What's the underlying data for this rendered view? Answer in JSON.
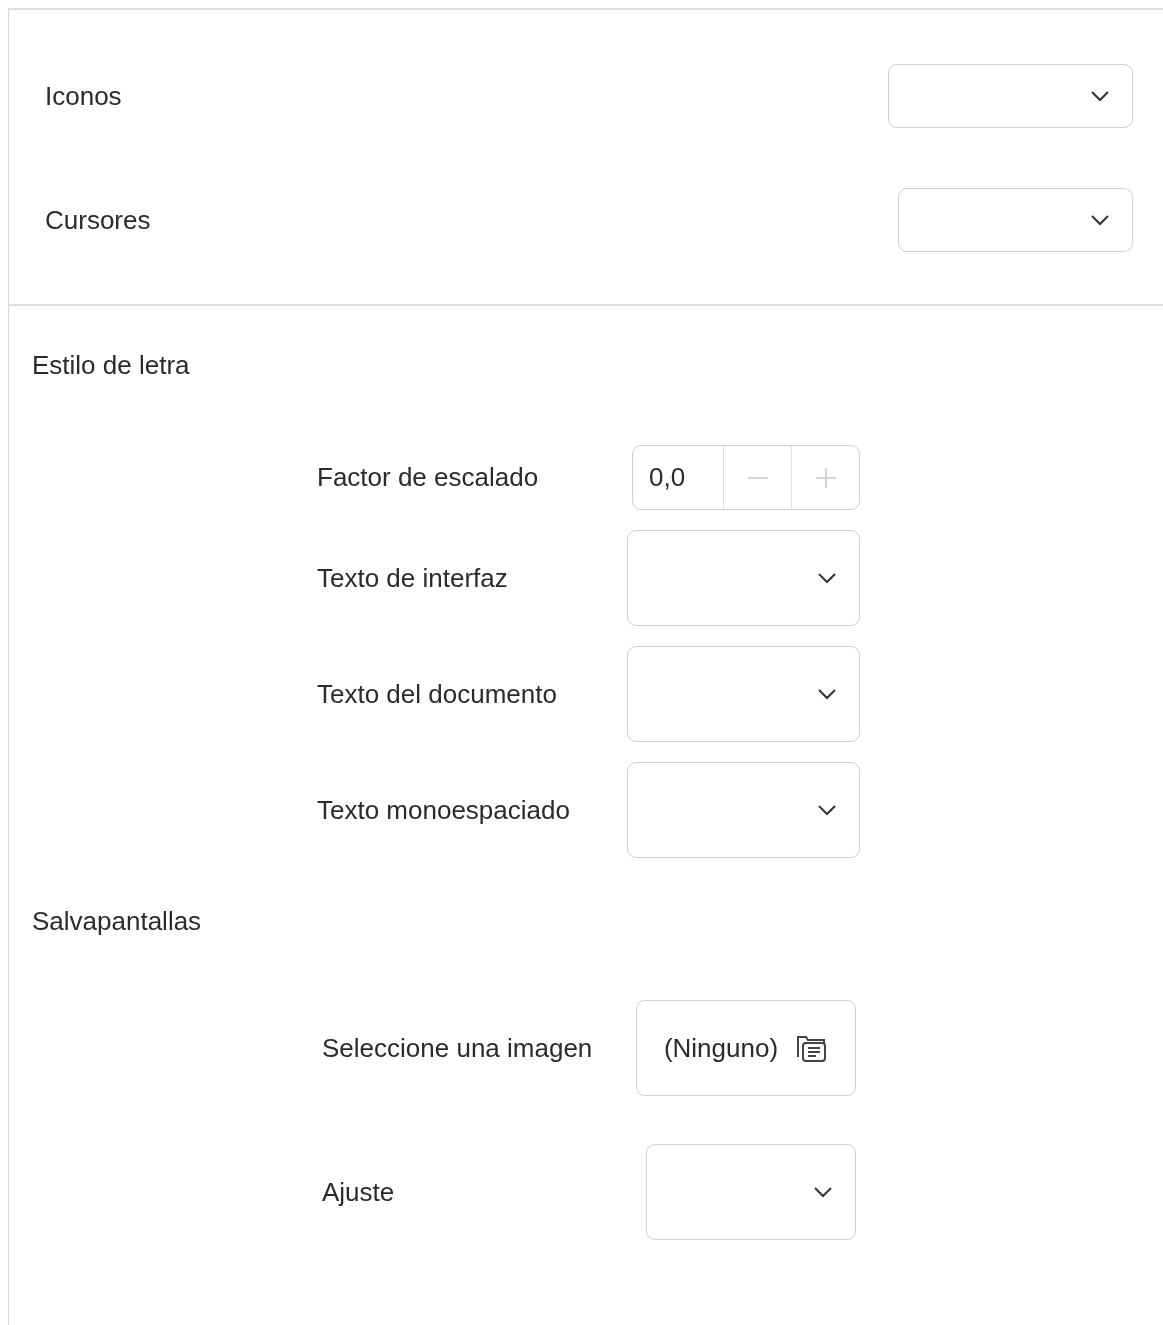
{
  "theme_panel": {
    "rows": [
      {
        "label": "Iconos",
        "kind": "dropdown"
      },
      {
        "label": "Cursores",
        "kind": "dropdown"
      }
    ]
  },
  "sections": [
    {
      "title": "Estilo de letra",
      "rows": [
        {
          "label": "Factor de escalado",
          "kind": "spin",
          "value": "0,0",
          "decrement_disabled": true,
          "increment_disabled": true
        },
        {
          "label": "Texto de interfaz",
          "kind": "dropdown"
        },
        {
          "label": "Texto del documento",
          "kind": "dropdown"
        },
        {
          "label": "Texto monoespaciado",
          "kind": "dropdown"
        }
      ]
    },
    {
      "title": "Salvapantallas",
      "rows": [
        {
          "label": "Seleccione una imagen",
          "kind": "file",
          "value": "(Ninguno)"
        },
        {
          "label": "Ajuste",
          "kind": "dropdown"
        }
      ]
    }
  ]
}
